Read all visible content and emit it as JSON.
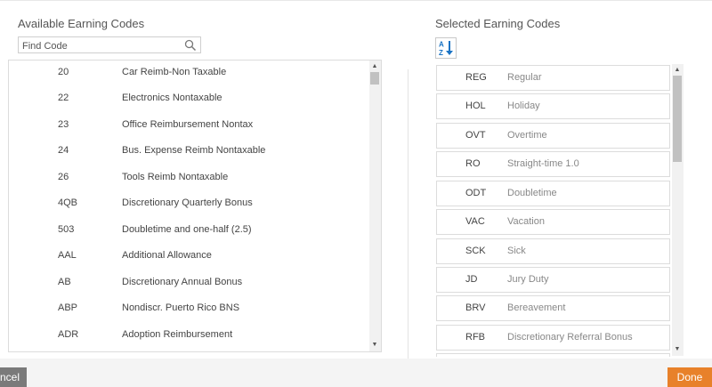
{
  "left_panel": {
    "title": "Available Earning Codes",
    "search_placeholder": "Find Code",
    "items": [
      {
        "code": "20",
        "description": "Car Reimb-Non Taxable"
      },
      {
        "code": "22",
        "description": "Electronics Nontaxable"
      },
      {
        "code": "23",
        "description": "Office Reimbursement Nontax"
      },
      {
        "code": "24",
        "description": "Bus. Expense Reimb Nontaxable"
      },
      {
        "code": "26",
        "description": "Tools Reimb Nontaxable"
      },
      {
        "code": "4QB",
        "description": "Discretionary Quarterly Bonus"
      },
      {
        "code": "503",
        "description": "Doubletime and one-half (2.5)"
      },
      {
        "code": "AAL",
        "description": "Additional Allowance"
      },
      {
        "code": "AB",
        "description": "Discretionary Annual Bonus"
      },
      {
        "code": "ABP",
        "description": "Nondiscr. Puerto Rico BNS"
      },
      {
        "code": "ADR",
        "description": "Adoption Reimbursement"
      }
    ]
  },
  "right_panel": {
    "title": "Selected Earning Codes",
    "sort_icon": "sort-alpha-icon",
    "items": [
      {
        "code": "REG",
        "description": "Regular"
      },
      {
        "code": "HOL",
        "description": "Holiday"
      },
      {
        "code": "OVT",
        "description": "Overtime"
      },
      {
        "code": "RO",
        "description": "Straight-time 1.0"
      },
      {
        "code": "ODT",
        "description": "Doubletime"
      },
      {
        "code": "VAC",
        "description": "Vacation"
      },
      {
        "code": "SCK",
        "description": "Sick"
      },
      {
        "code": "JD",
        "description": "Jury Duty"
      },
      {
        "code": "BRV",
        "description": "Bereavement"
      },
      {
        "code": "RFB",
        "description": "Discretionary Referral Bonus"
      }
    ]
  },
  "footer": {
    "cancel_label": "ncel",
    "done_label": "Done"
  },
  "colors": {
    "done_bg": "#e8812a",
    "cancel_bg": "#7a7a7a",
    "sort_icon_blue": "#1a73c4"
  }
}
